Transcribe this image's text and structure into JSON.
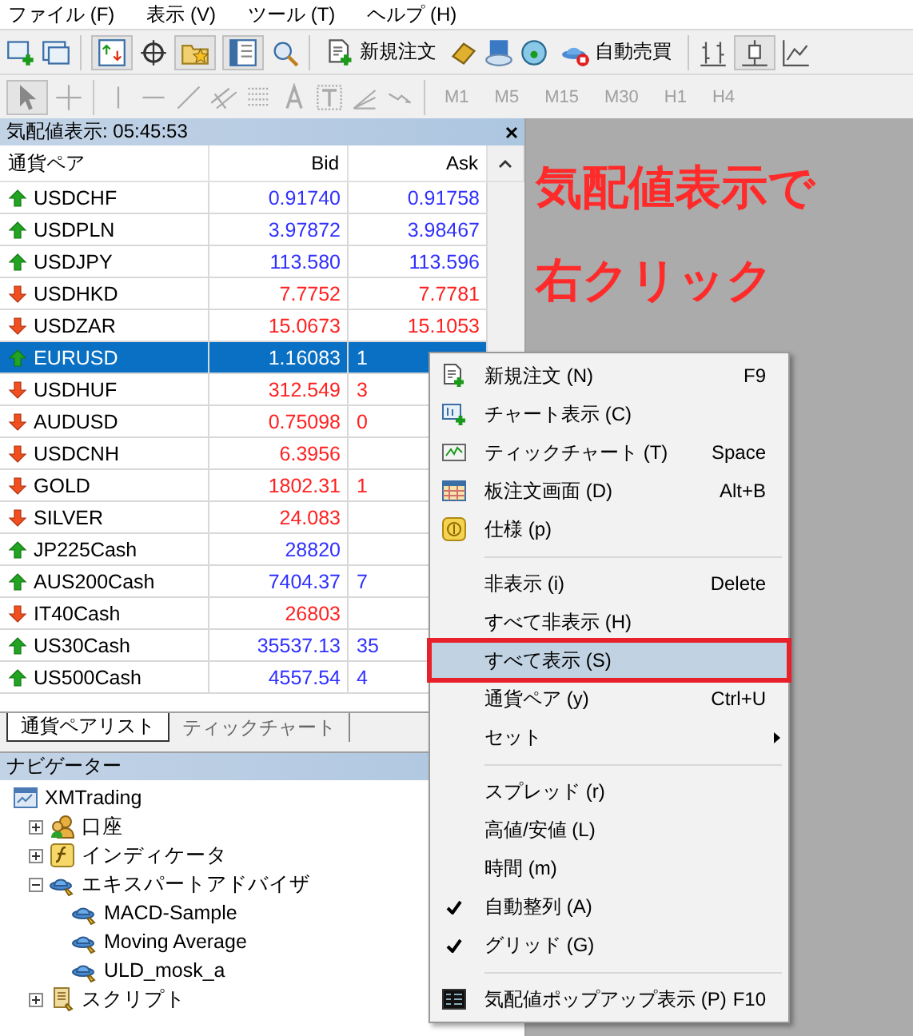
{
  "menu_bar": [
    "ファイル (F)",
    "表示 (V)",
    "ツール (T)",
    "ヘルプ (H)"
  ],
  "toolbar": {
    "buttons": [
      {
        "label": "新規注文"
      },
      {
        "label": "自動売買"
      }
    ]
  },
  "timeframes": [
    {
      "label": "M1",
      "disabled": true
    },
    {
      "label": "M5",
      "disabled": true
    },
    {
      "label": "M15",
      "disabled": true
    },
    {
      "label": "M30",
      "disabled": true
    },
    {
      "label": "H1",
      "disabled": true
    },
    {
      "label": "H4",
      "disabled": true
    }
  ],
  "market_watch": {
    "title": "気配値表示: 05:45:53",
    "columns": [
      "通貨ペア",
      "Bid",
      "Ask"
    ],
    "rows": [
      {
        "symbol": "USDCHF",
        "rising": true,
        "bid": "0.91740",
        "ask": "0.91758",
        "ask_clipped": false,
        "selected": false
      },
      {
        "symbol": "USDPLN",
        "rising": true,
        "bid": "3.97872",
        "ask": "3.98467",
        "ask_clipped": false,
        "selected": false
      },
      {
        "symbol": "USDJPY",
        "rising": true,
        "bid": "113.580",
        "ask": "113.596",
        "ask_clipped": false,
        "selected": false
      },
      {
        "symbol": "USDHKD",
        "rising": false,
        "bid": "7.7752",
        "ask": "7.7781",
        "ask_clipped": false,
        "selected": false
      },
      {
        "symbol": "USDZAR",
        "rising": false,
        "bid": "15.0673",
        "ask": "15.1053",
        "ask_clipped": false,
        "selected": false
      },
      {
        "symbol": "EURUSD",
        "rising": true,
        "bid": "1.16083",
        "ask": "1",
        "ask_clipped": true,
        "selected": true
      },
      {
        "symbol": "USDHUF",
        "rising": false,
        "bid": "312.549",
        "ask": "3",
        "ask_clipped": true,
        "selected": false
      },
      {
        "symbol": "AUDUSD",
        "rising": false,
        "bid": "0.75098",
        "ask": "0",
        "ask_clipped": true,
        "selected": false
      },
      {
        "symbol": "USDCNH",
        "rising": false,
        "bid": "6.3956",
        "selected": false
      },
      {
        "symbol": "GOLD",
        "rising": false,
        "bid": "1802.31",
        "ask": "1",
        "ask_clipped": true,
        "selected": false
      },
      {
        "symbol": "SILVER",
        "rising": false,
        "bid": "24.083",
        "selected": false
      },
      {
        "symbol": "JP225Cash",
        "rising": true,
        "bid": "28820",
        "selected": false
      },
      {
        "symbol": "AUS200Cash",
        "rising": true,
        "bid": "7404.37",
        "ask": "7",
        "ask_clipped": true,
        "selected": false
      },
      {
        "symbol": "IT40Cash",
        "rising": false,
        "bid": "26803",
        "selected": false
      },
      {
        "symbol": "US30Cash",
        "rising": true,
        "bid": "35537.13",
        "ask": "35",
        "ask_clipped": true,
        "selected": false
      },
      {
        "symbol": "US500Cash",
        "rising": true,
        "bid": "4557.54",
        "ask": "4",
        "ask_clipped": true,
        "selected": false
      }
    ]
  },
  "tabs": [
    {
      "label": "通貨ペアリスト",
      "selected": true
    },
    {
      "label": "ティックチャート",
      "selected": false
    }
  ],
  "navigator": {
    "title": "ナビゲーター",
    "tree": [
      {
        "label": "XMTrading",
        "kind": "terminal",
        "children": [
          {
            "label": "口座",
            "kind": "accounts",
            "expanded": false
          },
          {
            "label": "インディケータ",
            "kind": "indicators",
            "expanded": false
          },
          {
            "label": "エキスパートアドバイザ",
            "kind": "experts",
            "expanded": true,
            "children": [
              {
                "label": "MACD-Sample",
                "kind": "expert"
              },
              {
                "label": "Moving Average",
                "kind": "expert"
              },
              {
                "label": "ULD_mosk_a",
                "kind": "expert"
              }
            ]
          },
          {
            "label": "スクリプト",
            "kind": "scripts",
            "expanded": false
          }
        ]
      }
    ]
  },
  "annotation": [
    "気配値表示で",
    "右クリック"
  ],
  "context_menu": {
    "items": [
      {
        "kind": "item",
        "label": "新規注文 (N)",
        "shortcut": "F9",
        "checked": false,
        "submenu": false,
        "selected": false
      },
      {
        "kind": "item",
        "label": "チャート表示 (C)",
        "checked": false,
        "submenu": false,
        "selected": false
      },
      {
        "kind": "item",
        "label": "ティックチャート (T)",
        "shortcut": "Space",
        "checked": false,
        "submenu": false,
        "selected": false
      },
      {
        "kind": "item",
        "label": "板注文画面 (D)",
        "shortcut": "Alt+B",
        "checked": false,
        "submenu": false,
        "selected": false
      },
      {
        "kind": "item",
        "label": "仕様 (p)",
        "checked": false,
        "submenu": false,
        "selected": false
      },
      {
        "kind": "separator"
      },
      {
        "kind": "item",
        "label": "非表示 (i)",
        "shortcut": "Delete",
        "checked": false,
        "submenu": false,
        "selected": false
      },
      {
        "kind": "item",
        "label": "すべて非表示 (H)",
        "checked": false,
        "submenu": false,
        "selected": false
      },
      {
        "kind": "item",
        "label": "すべて表示 (S)",
        "checked": false,
        "submenu": false,
        "selected": true
      },
      {
        "kind": "item",
        "label": "通貨ペア (y)",
        "shortcut": "Ctrl+U",
        "checked": false,
        "submenu": false,
        "selected": false
      },
      {
        "kind": "item",
        "label": "セット",
        "checked": false,
        "submenu": true,
        "selected": false
      },
      {
        "kind": "separator"
      },
      {
        "kind": "item",
        "label": "スプレッド (r)",
        "checked": false,
        "submenu": false,
        "selected": false
      },
      {
        "kind": "item",
        "label": "高値/安値 (L)",
        "checked": false,
        "submenu": false,
        "selected": false
      },
      {
        "kind": "item",
        "label": "時間 (m)",
        "checked": false,
        "submenu": false,
        "selected": false
      },
      {
        "kind": "item",
        "label": "自動整列 (A)",
        "checked": true,
        "submenu": false,
        "selected": false
      },
      {
        "kind": "item",
        "label": "グリッド (G)",
        "checked": true,
        "submenu": false,
        "selected": false
      },
      {
        "kind": "separator"
      },
      {
        "kind": "item",
        "label": "気配値ポップアップ表示 (P)",
        "shortcut": "F10",
        "checked": false,
        "submenu": false,
        "selected": false
      }
    ]
  }
}
